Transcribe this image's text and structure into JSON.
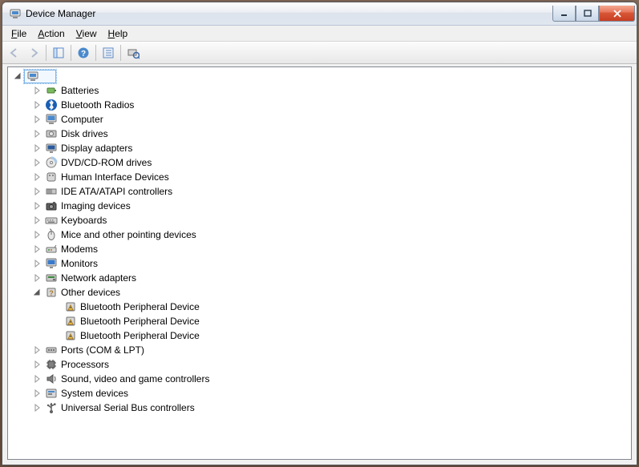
{
  "window": {
    "title": "Device Manager"
  },
  "menu": {
    "file": "File",
    "action": "Action",
    "view": "View",
    "help": "Help"
  },
  "tree": {
    "root": "",
    "categories": [
      {
        "label": "Batteries",
        "icon": "battery"
      },
      {
        "label": "Bluetooth Radios",
        "icon": "bluetooth"
      },
      {
        "label": "Computer",
        "icon": "computer"
      },
      {
        "label": "Disk drives",
        "icon": "disk"
      },
      {
        "label": "Display adapters",
        "icon": "display"
      },
      {
        "label": "DVD/CD-ROM drives",
        "icon": "cdrom"
      },
      {
        "label": "Human Interface Devices",
        "icon": "hid"
      },
      {
        "label": "IDE ATA/ATAPI controllers",
        "icon": "ide"
      },
      {
        "label": "Imaging devices",
        "icon": "imaging"
      },
      {
        "label": "Keyboards",
        "icon": "keyboard"
      },
      {
        "label": "Mice and other pointing devices",
        "icon": "mouse"
      },
      {
        "label": "Modems",
        "icon": "modem"
      },
      {
        "label": "Monitors",
        "icon": "monitor"
      },
      {
        "label": "Network adapters",
        "icon": "network"
      },
      {
        "label": "Other devices",
        "icon": "other",
        "expanded": true,
        "children": [
          {
            "label": "Bluetooth Peripheral Device",
            "icon": "warn"
          },
          {
            "label": "Bluetooth Peripheral Device",
            "icon": "warn"
          },
          {
            "label": "Bluetooth Peripheral Device",
            "icon": "warn"
          }
        ]
      },
      {
        "label": "Ports (COM & LPT)",
        "icon": "ports"
      },
      {
        "label": "Processors",
        "icon": "cpu"
      },
      {
        "label": "Sound, video and game controllers",
        "icon": "sound"
      },
      {
        "label": "System devices",
        "icon": "system"
      },
      {
        "label": "Universal Serial Bus controllers",
        "icon": "usb"
      }
    ]
  }
}
